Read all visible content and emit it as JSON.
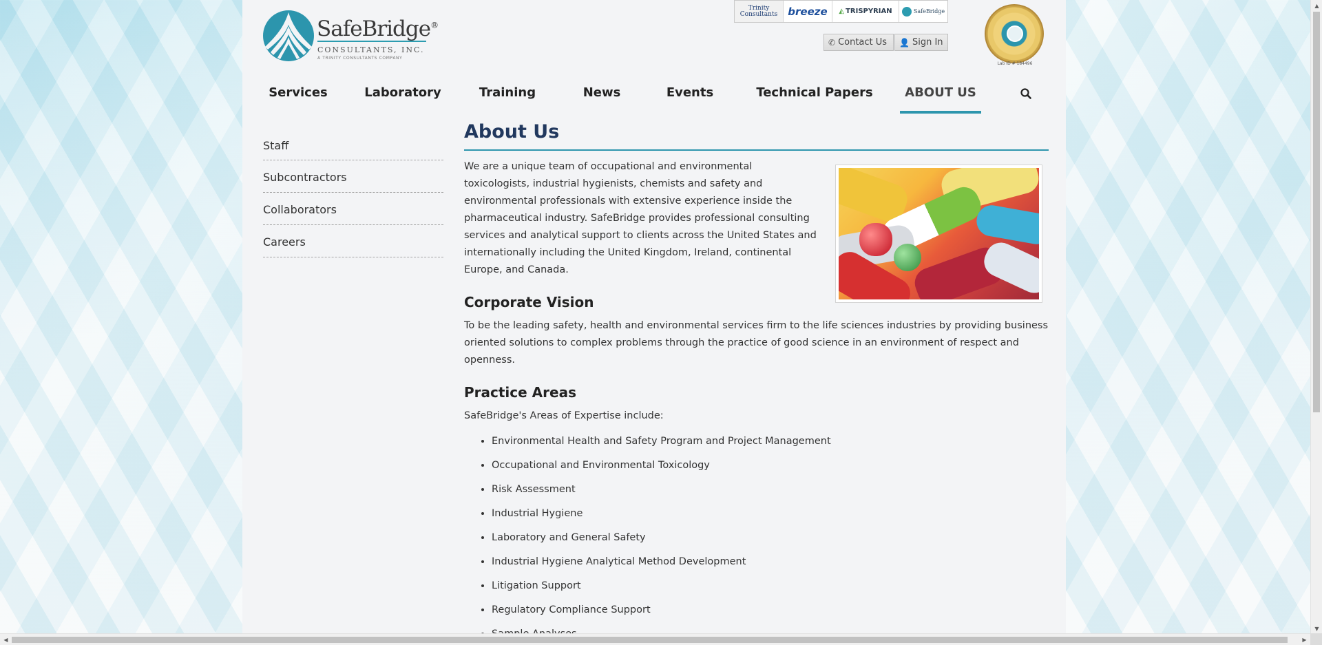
{
  "header": {
    "logo": {
      "name": "SafeBridge",
      "registered": "®",
      "subtitle": "CONSULTANTS, INC.",
      "tagline": "A TRINITY CONSULTANTS COMPANY"
    },
    "partners": [
      {
        "label": "Trinity Consultants"
      },
      {
        "label": "breeze"
      },
      {
        "label": "TRISPYRIAN"
      },
      {
        "label": "SafeBridge"
      }
    ],
    "contact_label": "Contact Us",
    "signin_label": "Sign In",
    "seal_caption": "Lab ID # 184496"
  },
  "nav": {
    "items": [
      {
        "label": "Services"
      },
      {
        "label": "Laboratory"
      },
      {
        "label": "Training"
      },
      {
        "label": "News"
      },
      {
        "label": "Events"
      },
      {
        "label": "Technical Papers"
      },
      {
        "label": "ABOUT US",
        "active": true
      }
    ],
    "search_icon": "search-icon"
  },
  "sidebar": {
    "items": [
      {
        "label": "Staff"
      },
      {
        "label": "Subcontractors"
      },
      {
        "label": "Collaborators"
      },
      {
        "label": "Careers"
      }
    ]
  },
  "main": {
    "title": "About Us",
    "intro": "We are a unique team of occupational and environmental toxicologists, industrial hygienists, chemists and safety and environmental professionals with extensive experience inside the pharmaceutical industry. SafeBridge provides professional consulting services and analytical support to clients across the United States and internationally including the United Kingdom, Ireland, continental Europe, and Canada.",
    "vision_heading": "Corporate Vision",
    "vision_text": "To be the leading safety, health and environmental services firm to the life sciences industries by providing business oriented solutions to complex problems through the practice of good science in an environment of respect and openness.",
    "practice_heading": "Practice Areas",
    "practice_intro": "SafeBridge's Areas of Expertise include:",
    "practice_items": [
      "Environmental Health and Safety Program and Project Management",
      "Occupational and Environmental Toxicology",
      "Risk Assessment",
      "Industrial Hygiene",
      "Laboratory and General Safety",
      "Industrial Hygiene Analytical Method Development",
      "Litigation Support",
      "Regulatory Compliance Support",
      "Sample Analyses"
    ]
  },
  "colors": {
    "accent": "#2c95ad",
    "title": "#21385e",
    "page_bg": "#f3f4f6"
  }
}
